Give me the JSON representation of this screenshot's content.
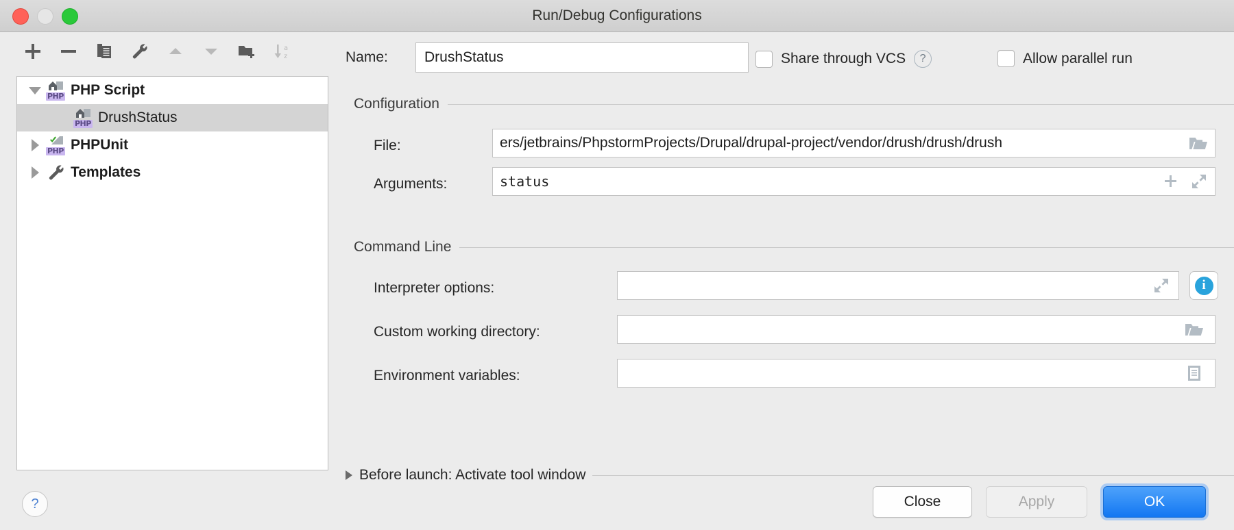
{
  "window": {
    "title": "Run/Debug Configurations",
    "traffic_lights": [
      "close",
      "minimize",
      "zoom"
    ]
  },
  "toolbar": {
    "buttons": [
      {
        "name": "add",
        "icon": "plus-icon",
        "label": "Add New Configuration",
        "enabled": true
      },
      {
        "name": "remove",
        "icon": "minus-icon",
        "label": "Remove Configuration",
        "enabled": true
      },
      {
        "name": "copy",
        "icon": "copy-icon",
        "label": "Copy Configuration",
        "enabled": true
      },
      {
        "name": "edit-templates",
        "icon": "wrench-icon",
        "label": "Edit Templates",
        "enabled": true
      },
      {
        "name": "move-up",
        "icon": "arrow-up-icon",
        "label": "Move Up",
        "enabled": false
      },
      {
        "name": "move-down",
        "icon": "arrow-down-icon",
        "label": "Move Down",
        "enabled": false
      },
      {
        "name": "new-folder",
        "icon": "new-folder-icon",
        "label": "Create New Folder",
        "enabled": true
      },
      {
        "name": "sort",
        "icon": "sort-alphabetically-icon",
        "label": "Sort Configurations",
        "enabled": false
      }
    ]
  },
  "tree": {
    "items": [
      {
        "label": "PHP Script",
        "icon": "php-script-icon",
        "twisty": "down",
        "level": 0,
        "selected": false,
        "bold": true
      },
      {
        "label": "DrushStatus",
        "icon": "php-script-icon",
        "twisty": "none",
        "level": 1,
        "selected": true,
        "bold": false
      },
      {
        "label": "PHPUnit",
        "icon": "phpunit-icon",
        "twisty": "right",
        "level": 0,
        "selected": false,
        "bold": true
      },
      {
        "label": "Templates",
        "icon": "wrench-icon",
        "twisty": "right",
        "level": 0,
        "selected": false,
        "bold": true
      }
    ]
  },
  "form": {
    "name_label": "Name:",
    "name_value": "DrushStatus",
    "share_through_vcs": {
      "label": "Share through VCS",
      "checked": false,
      "help": "?"
    },
    "allow_parallel_run": {
      "label": "Allow parallel run",
      "checked": false
    },
    "configuration": {
      "title": "Configuration",
      "file_label": "File:",
      "file_value": "ers/jetbrains/PhpstormProjects/Drupal/drupal-project/vendor/drush/drush/drush",
      "file_icon": "folder-browse-icon",
      "arguments_label": "Arguments:",
      "arguments_value": "status",
      "arguments_icons": [
        "insert-macro-icon",
        "expand-editor-icon"
      ]
    },
    "command_line": {
      "title": "Command Line",
      "interpreter_options_label": "Interpreter options:",
      "interpreter_options_value": "",
      "interpreter_options_icon": "expand-editor-icon",
      "interpreter_info_icon": "info-icon",
      "interpreter_info_glyph": "i",
      "custom_working_directory_label": "Custom working directory:",
      "custom_working_directory_value": "",
      "custom_working_directory_icon": "folder-browse-icon",
      "environment_variables_label": "Environment variables:",
      "environment_variables_value": "",
      "environment_variables_icon": "env-list-icon"
    },
    "before_launch": {
      "label": "Before launch: Activate tool window",
      "expanded": false
    }
  },
  "footer": {
    "help_glyph": "?",
    "buttons": [
      {
        "name": "close",
        "label": "Close",
        "style": "default"
      },
      {
        "name": "apply",
        "label": "Apply",
        "style": "disabled"
      },
      {
        "name": "ok",
        "label": "OK",
        "style": "primary"
      }
    ]
  },
  "colors": {
    "window_bg": "#ececec",
    "accent_blue": "#1277f2",
    "info_blue": "#29a3dc",
    "php_tag_bg": "#c9b6ef",
    "selection_gray": "#d4d4d4"
  }
}
